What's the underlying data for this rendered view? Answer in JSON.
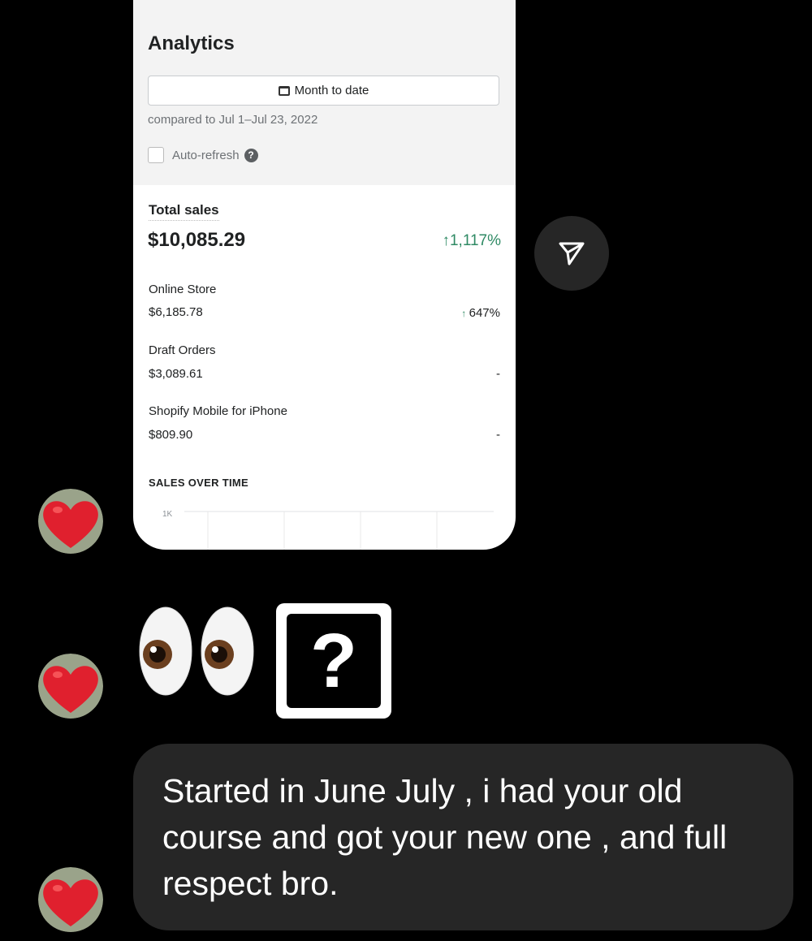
{
  "analytics": {
    "title": "Analytics",
    "date_button": "Month to date",
    "compared_to": "compared to Jul 1–Jul 23, 2022",
    "auto_refresh_label": "Auto-refresh",
    "help_icon": "?",
    "total_sales": {
      "label": "Total sales",
      "value": "$10,085.29",
      "change": "1,117%"
    },
    "channels": [
      {
        "name": "Online Store",
        "value": "$6,185.78",
        "change": "647%",
        "trend": "up"
      },
      {
        "name": "Draft Orders",
        "value": "$3,089.61",
        "change": "-"
      },
      {
        "name": "Shopify Mobile for iPhone",
        "value": "$809.90",
        "change": "-"
      }
    ],
    "sales_over_time": {
      "label": "SALES OVER TIME",
      "y_tick": "1K"
    }
  },
  "icons": {
    "send": "paper-plane-icon",
    "reaction": "heart-icon",
    "calendar": "calendar-icon",
    "eyes": "eyes-emoji",
    "question": "question-mark-emoji"
  },
  "message": {
    "text": "Started in June July , i had your old course and got your new one , and full respect bro."
  },
  "colors": {
    "background": "#000000",
    "bubble": "#262626",
    "positive": "#2f8a64",
    "heart": "#e0202e"
  }
}
